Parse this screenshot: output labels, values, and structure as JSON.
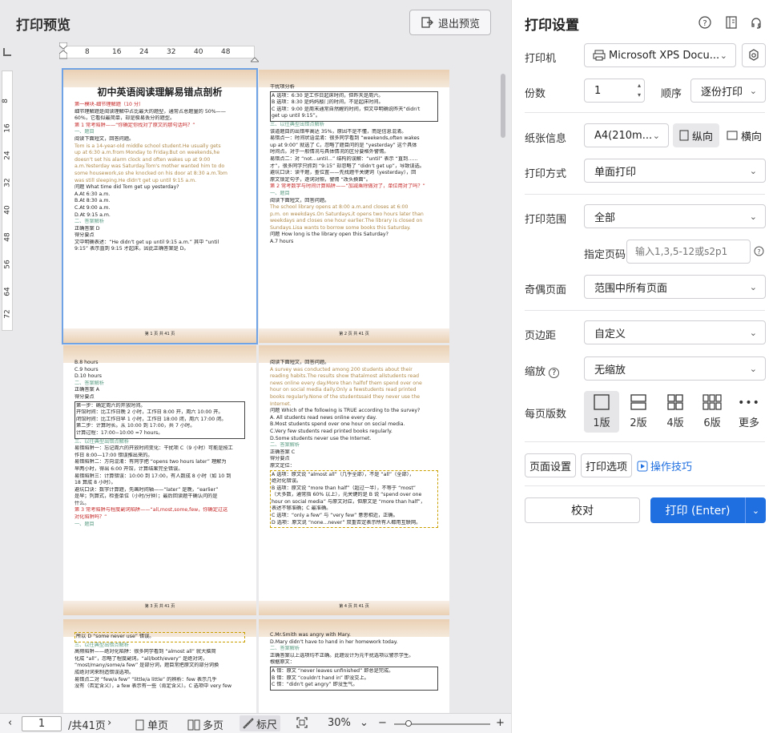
{
  "left": {
    "title": "打印预览",
    "exit_label": "退出预览",
    "hruler_ticks": [
      "8",
      "16",
      "24",
      "32",
      "40",
      "48"
    ],
    "vruler_ticks": [
      "8",
      "16",
      "24",
      "32",
      "40",
      "48",
      "56",
      "64",
      "72"
    ],
    "pages": {
      "p1": {
        "title": "初中英语阅读理解易错点剖析",
        "lines": [
          {
            "t": "第一模块-细节理解题（10 分）",
            "c": "r"
          },
          {
            "t": "细节理解题是阅读理解中占比最大的题型，通常占总题量的 50%——",
            "c": ""
          },
          {
            "t": "60%，它看似最简单，却是极易丢分的题型。",
            "c": ""
          },
          {
            "t": "第 1 常考陷阱——“你确定你找对了原文的那句话吗？”",
            "c": "r"
          },
          {
            "t": "一、题目",
            "c": "g"
          },
          {
            "t": "阅读下面短文，回答问题。",
            "c": ""
          },
          {
            "t": "Tom is a 14-year-old middle school student.He usually gets",
            "c": "o"
          },
          {
            "t": "up at 6:30 a.m.from Monday to Friday.But on weekends,he",
            "c": "o"
          },
          {
            "t": "doesn't set his alarm clock and often wakes up at 9:00",
            "c": "o"
          },
          {
            "t": "a.m.Yesterday was Saturday.Tom's mother wanted him to do",
            "c": "o"
          },
          {
            "t": "some housework,so she knocked on his door at 8:30 a.m.Tom",
            "c": "o"
          },
          {
            "t": "was still sleeping.He didn't get up until 9:15 a.m.",
            "c": "o"
          },
          {
            "t": "问题 What time did Tom get up yesterday?",
            "c": ""
          },
          {
            "t": "A.At 6:30 a.m.",
            "c": ""
          },
          {
            "t": "B.At 8:30 a.m.",
            "c": ""
          },
          {
            "t": "C.At 9:00 a.m.",
            "c": ""
          },
          {
            "t": "D.At 9:15 a.m.",
            "c": ""
          },
          {
            "t": "二、答案解析",
            "c": "g"
          },
          {
            "t": "正确答案 D",
            "c": ""
          },
          {
            "t": "得分要点",
            "c": ""
          },
          {
            "t": "文中明确表述：“He didn't get up until 9:15 a.m.” 其中 “until",
            "c": ""
          },
          {
            "t": "9:15” 表示直到 9:15 才起床。因此正确答案是 D。",
            "c": ""
          }
        ],
        "footer": "第 1 页 共 41 页"
      },
      "p2": {
        "lines": [
          {
            "t": "干扰项分析",
            "c": ""
          },
          {
            "t": "A 选项：6:30 是工作日起床时间，但昨天是周六。",
            "c": "box"
          },
          {
            "t": "B 选项：8:30 是妈妈敲门的时间，不是起床时间。",
            "c": "box"
          },
          {
            "t": "C 选项：9:00 是周末通常自然醒的时间，但文中明确说昨天“didn't",
            "c": "box"
          },
          {
            "t": "get up until 9:15”。",
            "c": "box"
          },
          {
            "t": "三、以往典型出错点解析",
            "c": "g"
          },
          {
            "t": "该道题目的出错率高达 35%，原因不是不懂，而是信息混淆。",
            "c": ""
          },
          {
            "t": "易错点一：时间状语混淆：很多同学看到 “weekends,often wakes",
            "c": ""
          },
          {
            "t": "up at 9:00” 就选了 C，忽略了题目问的是 “yesterday” 这个具体",
            "c": ""
          },
          {
            "t": "时间点。对于一般情况与具体情况的区分要格外警惕。",
            "c": ""
          },
          {
            "t": "易错点二：对 “not...until...” 结构的误解：“until” 表示 “直到……",
            "c": ""
          },
          {
            "t": "才”，很多同学只抓到 “9:15” 却忽略了 “didn't get up”，导致误选。",
            "c": ""
          },
          {
            "t": "避坑口诀：读干题，查位置——先找题干关键词（yesterday），回",
            "c": ""
          },
          {
            "t": "原文锁定句子，逐词对照，警惕 “改头换面”。",
            "c": ""
          },
          {
            "t": "第 2 常考数字与时间计算陷阱——“加减乘除做对了，单位用对了吗？”",
            "c": "r"
          },
          {
            "t": "一、题目",
            "c": "g"
          },
          {
            "t": "阅读下面短文，回答问题。",
            "c": ""
          },
          {
            "t": "The school library opens at 8:00 a.m.and closes at 6:00",
            "c": "o"
          },
          {
            "t": "p.m. on weekdays.On Saturdays,it opens two hours later than",
            "c": "o"
          },
          {
            "t": "weekdays and closes one hour earlier.The library is closed on",
            "c": "o"
          },
          {
            "t": "Sundays.Lisa wants to borrow some books this Saturday.",
            "c": "o"
          },
          {
            "t": "问题 How long is the library open this Saturday?",
            "c": ""
          },
          {
            "t": "A.7 hours",
            "c": ""
          }
        ],
        "footer": "第 2 页 共 41 页"
      },
      "p3": {
        "lines": [
          {
            "t": "B.8 hours",
            "c": ""
          },
          {
            "t": "C.9 hours",
            "c": ""
          },
          {
            "t": "D.10 hours",
            "c": ""
          },
          {
            "t": "二、答案解析",
            "c": "g"
          },
          {
            "t": "正确答案 A",
            "c": ""
          },
          {
            "t": "得分要点",
            "c": ""
          },
          {
            "t": "第一步：确定周六的开放时间。",
            "c": "box"
          },
          {
            "t": "开馆时间：比工作日晚 2 小时，工作日 8:00 开，周六 10:00 开。",
            "c": "box"
          },
          {
            "t": "闭馆时间：比工作日早 1 小时，工作日 18:00 闭，周六 17:00 闭。",
            "c": "box"
          },
          {
            "t": "第二步：计算时长。从 10:00 到 17:00，共 7 小时。",
            "c": "box"
          },
          {
            "t": "计算过程：17:00−10:00 =7 hours。",
            "c": "box"
          },
          {
            "t": "三、以往典型出错点解析",
            "c": "g"
          },
          {
            "t": "易错陷阱一：忘记周六的开放时间变化：干扰项 C（9 小时）可能是按工",
            "c": ""
          },
          {
            "t": "作日 8:00—17:00 错误推出来的。",
            "c": ""
          },
          {
            "t": "易错陷阱二：方向混淆：有同学把 “opens two hours later” 理解为",
            "c": ""
          },
          {
            "t": "早两小时，得出 6:00 开馆，计算结果完全错误。",
            "c": ""
          },
          {
            "t": "易错陷阱三：计算错误：10:00 到 17:00，有人数成 8 小时（如 10 到",
            "c": ""
          },
          {
            "t": "18 算成 8 小时）。",
            "c": ""
          },
          {
            "t": "避坑口诀：数字计算题，先画时间轴——“later” 是晚，“earlier”",
            "c": ""
          },
          {
            "t": "是早；列算式，检查单位（小时/分钟）；最后回读题干确认问的是",
            "c": ""
          },
          {
            "t": "什么。",
            "c": ""
          },
          {
            "t": "第 3 常考陷阱与程度副词陷阱——“all,most,some,few，你确定过这",
            "c": "r"
          },
          {
            "t": "对化陷阱吗？”",
            "c": "r"
          },
          {
            "t": "一、题目",
            "c": "g"
          }
        ],
        "footer": "第 3 页 共 41 页"
      },
      "p4": {
        "lines": [
          {
            "t": "阅读下面短文，回答问题。",
            "c": ""
          },
          {
            "t": "A survey was conducted among 200 students about their",
            "c": "o"
          },
          {
            "t": "reading habits.The results show thatalmost allstudents read",
            "c": "o"
          },
          {
            "t": "news online every day.More than halfof them spend over one",
            "c": "o"
          },
          {
            "t": "hour on social media daily.Only a fewstudents read printed",
            "c": "o"
          },
          {
            "t": "books regularly.None of the studentssaid they never use the",
            "c": "o"
          },
          {
            "t": "Internet.",
            "c": "o"
          },
          {
            "t": "问题 Which of the following is TRUE according to the survey?",
            "c": ""
          },
          {
            "t": "A. All students read news online every day.",
            "c": ""
          },
          {
            "t": "B.Most students spend over one hour on social media.",
            "c": ""
          },
          {
            "t": "C.Very few students read printed books regularly.",
            "c": ""
          },
          {
            "t": "D.Some students never use the Internet.",
            "c": ""
          },
          {
            "t": "二、答案解析",
            "c": "g"
          },
          {
            "t": "正确答案 C",
            "c": ""
          },
          {
            "t": "得分要点",
            "c": ""
          },
          {
            "t": "原文定位：",
            "c": ""
          },
          {
            "t": "A 选项：原文说 “almost all”（几乎全部），不是 “all”（全部），",
            "c": "dash"
          },
          {
            "t": "绝对化错误。",
            "c": "dash"
          },
          {
            "t": "B 选项：原文说 “more than half”（超过一半），不等于 “most”",
            "c": "dash"
          },
          {
            "t": "（大多数，通常指 60% 以上），元关键的是 B 说 “spend over one",
            "c": "dash"
          },
          {
            "t": "hour on social media” 与原文对应，但原文是 “more than half”，",
            "c": "dash"
          },
          {
            "t": "表述不够准确；C 最准确。",
            "c": "dash"
          },
          {
            "t": "C 选项：“only a few” 与 “very few” 意思相近，正确。",
            "c": "dash"
          },
          {
            "t": "D 选项：原文说 “none...never” 双重否定表示所有人都用互联网。",
            "c": "dash"
          }
        ],
        "footer": "第 4 页 共 41 页"
      },
      "p5": {
        "lines": [
          {
            "t": "所以 D “some never use” 错误。",
            "c": "dash"
          },
          {
            "t": "三、以往典型出错点解析",
            "c": "g"
          },
          {
            "t": "高频陷阱——绝对化陷阱：很多同学看到 “almost all” 就大脑简",
            "c": ""
          },
          {
            "t": "化成 “all”，忽略了程度副词。“all/both/every” 是绝对词，",
            "c": ""
          },
          {
            "t": "“most/many/some/a few” 是部分词，题目常把原文的部分词换",
            "c": ""
          },
          {
            "t": "成绝对词来制造错误选项。",
            "c": ""
          },
          {
            "t": "易错点二对 “few/a few” “little/a little” 的辨析：few 表示几乎",
            "c": ""
          },
          {
            "t": "没有（否定含义），a few 表示有一些（肯定含义）。C 选项中 very few",
            "c": ""
          }
        ]
      },
      "p6": {
        "lines": [
          {
            "t": "C.Mr.Smith was angry with Mary.",
            "c": ""
          },
          {
            "t": "D.Mary didn't have to hand in her homework today.",
            "c": ""
          },
          {
            "t": "二、答案解析",
            "c": "g"
          },
          {
            "t": "正确答案以上选项均不正确。此题设计为元干扰选项以警示学生。",
            "c": ""
          },
          {
            "t": "根据原文：",
            "c": ""
          },
          {
            "t": "A 错：原文 “never leaves unfinished” 即总是完成。",
            "c": "box"
          },
          {
            "t": "B 错：原文 “couldn't hand in” 即没交上。",
            "c": "box"
          },
          {
            "t": "C 错：“didn't get angry” 即没生气。",
            "c": "box"
          }
        ]
      }
    }
  },
  "bottom": {
    "page_value": "1",
    "total_pages": "/共41页",
    "single_label": "单页",
    "multi_label": "多页",
    "ruler_label": "标尺",
    "zoom": "30%",
    "zoom_fraction": 0.3
  },
  "right": {
    "title": "打印设置",
    "printer_label": "打印机",
    "printer_value": "Microsoft XPS Docu...",
    "copies_label": "份数",
    "copies_value": "1",
    "order_label": "顺序",
    "order_value": "逐份打印",
    "paper_label": "纸张信息",
    "paper_value": "A4(210m...",
    "portrait_label": "纵向",
    "landscape_label": "横向",
    "method_label": "打印方式",
    "method_value": "单面打印",
    "range_label": "打印范围",
    "range_value": "全部",
    "specify_label": "指定页码",
    "specify_placeholder": "输入1,3,5-12或s2p1",
    "oddeven_label": "奇偶页面",
    "oddeven_value": "范围中所有页面",
    "margin_label": "页边距",
    "margin_value": "自定义",
    "scale_label": "缩放",
    "scale_value": "无缩放",
    "perpage_label": "每页版数",
    "layouts": [
      "1版",
      "2版",
      "4版",
      "6版",
      "更多"
    ],
    "page_setup": "页面设置",
    "print_options": "打印选项",
    "tips": "操作技巧",
    "proof": "校对",
    "print": "打印 (Enter)",
    "accent": "#1f6fe0"
  }
}
